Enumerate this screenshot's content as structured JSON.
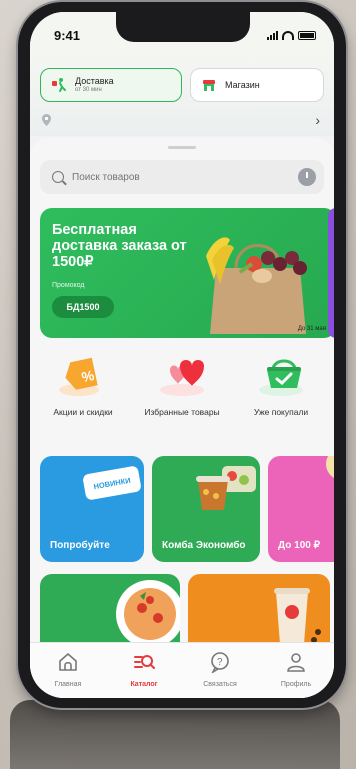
{
  "status_bar": {
    "time": "9:41"
  },
  "mode": {
    "delivery_title": "Доставка",
    "delivery_sub": "от 30 мин",
    "store_title": "Магазин"
  },
  "search": {
    "placeholder": "Поиск товаров"
  },
  "promo": {
    "title": "Бесплатная доставка заказа от 1500₽",
    "code_label": "Промокод",
    "code": "БД1500",
    "date": "До 31 мая"
  },
  "categories": [
    {
      "label": "Акции и скидки",
      "icon": "percent-tag-icon"
    },
    {
      "label": "Избранные товары",
      "icon": "hearts-icon"
    },
    {
      "label": "Уже покупали",
      "icon": "basket-icon"
    }
  ],
  "tiles": [
    {
      "label": "Попробуйте",
      "badge": "НОВИНКИ",
      "color": "#2a9be0"
    },
    {
      "label": "Комба Экономбо",
      "color": "#2faa55"
    },
    {
      "label": "До 100 ₽",
      "color": "#ec64b9"
    }
  ],
  "tabs": [
    {
      "label": "Главная",
      "icon": "home-icon"
    },
    {
      "label": "Каталог",
      "icon": "catalog-icon",
      "active": true
    },
    {
      "label": "Связаться",
      "icon": "help-icon"
    },
    {
      "label": "Профиль",
      "icon": "profile-icon"
    }
  ],
  "colors": {
    "brand_green": "#2fbd5e",
    "accent_red": "#e53b3b"
  }
}
